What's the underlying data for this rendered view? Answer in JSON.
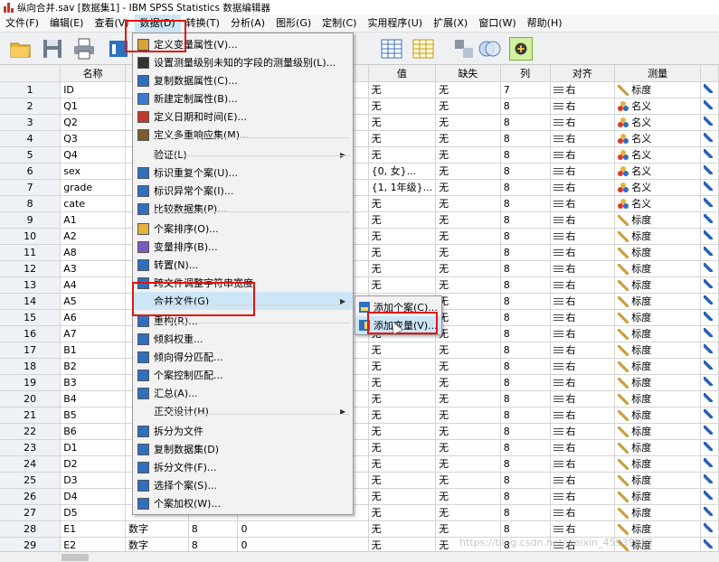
{
  "window": {
    "title": "纵向合并.sav [数据集1] - IBM SPSS Statistics 数据编辑器"
  },
  "menubar": [
    "文件(F)",
    "编辑(E)",
    "查看(V)",
    "数据(D)",
    "转换(T)",
    "分析(A)",
    "图形(G)",
    "定制(C)",
    "实用程序(U)",
    "扩展(X)",
    "窗口(W)",
    "帮助(H)"
  ],
  "grid": {
    "headers": [
      "名称",
      "值",
      "缺失",
      "列",
      "对齐",
      "测量"
    ],
    "rows": [
      {
        "n": "1",
        "name": "ID",
        "type": "",
        "width": "",
        "dec": "",
        "value": "无",
        "missing": "无",
        "cols": "7",
        "align": "右",
        "measure": "标度"
      },
      {
        "n": "2",
        "name": "Q1",
        "type": "",
        "width": "",
        "dec": "",
        "value": "无",
        "missing": "无",
        "cols": "8",
        "align": "右",
        "measure": "名义"
      },
      {
        "n": "3",
        "name": "Q2",
        "type": "",
        "width": "",
        "dec": "",
        "value": "无",
        "missing": "无",
        "cols": "8",
        "align": "右",
        "measure": "名义"
      },
      {
        "n": "4",
        "name": "Q3",
        "type": "",
        "width": "",
        "dec": "",
        "value": "无",
        "missing": "无",
        "cols": "8",
        "align": "右",
        "measure": "名义"
      },
      {
        "n": "5",
        "name": "Q4",
        "type": "",
        "width": "",
        "dec": "",
        "value": "无",
        "missing": "无",
        "cols": "8",
        "align": "右",
        "measure": "名义"
      },
      {
        "n": "6",
        "name": "sex",
        "type": "",
        "width": "",
        "dec": "",
        "value": "{0, 女}...",
        "missing": "无",
        "cols": "8",
        "align": "右",
        "measure": "名义"
      },
      {
        "n": "7",
        "name": "grade",
        "type": "",
        "width": "",
        "dec": "",
        "value": "{1, 1年级}...",
        "missing": "无",
        "cols": "8",
        "align": "右",
        "measure": "名义"
      },
      {
        "n": "8",
        "name": "cate",
        "type": "",
        "width": "",
        "dec": "",
        "value": "无",
        "missing": "无",
        "cols": "8",
        "align": "右",
        "measure": "名义"
      },
      {
        "n": "9",
        "name": "A1",
        "type": "",
        "width": "",
        "dec": "",
        "value": "无",
        "missing": "无",
        "cols": "8",
        "align": "右",
        "measure": "标度"
      },
      {
        "n": "10",
        "name": "A2",
        "type": "",
        "width": "",
        "dec": "",
        "value": "无",
        "missing": "无",
        "cols": "8",
        "align": "右",
        "measure": "标度"
      },
      {
        "n": "11",
        "name": "A8",
        "type": "",
        "width": "",
        "dec": "",
        "value": "无",
        "missing": "无",
        "cols": "8",
        "align": "右",
        "measure": "标度"
      },
      {
        "n": "12",
        "name": "A3",
        "type": "",
        "width": "",
        "dec": "",
        "value": "无",
        "missing": "无",
        "cols": "8",
        "align": "右",
        "measure": "标度"
      },
      {
        "n": "13",
        "name": "A4",
        "type": "",
        "width": "",
        "dec": "",
        "value": "无",
        "missing": "无",
        "cols": "8",
        "align": "右",
        "measure": "标度"
      },
      {
        "n": "14",
        "name": "A5",
        "type": "",
        "width": "",
        "dec": "",
        "value": "无",
        "missing": "无",
        "cols": "8",
        "align": "右",
        "measure": "标度"
      },
      {
        "n": "15",
        "name": "A6",
        "type": "",
        "width": "",
        "dec": "",
        "value": "无",
        "missing": "无",
        "cols": "8",
        "align": "右",
        "measure": "标度"
      },
      {
        "n": "16",
        "name": "A7",
        "type": "",
        "width": "",
        "dec": "",
        "value": "无",
        "missing": "无",
        "cols": "8",
        "align": "右",
        "measure": "标度"
      },
      {
        "n": "17",
        "name": "B1",
        "type": "",
        "width": "",
        "dec": "",
        "value": "无",
        "missing": "无",
        "cols": "8",
        "align": "右",
        "measure": "标度"
      },
      {
        "n": "18",
        "name": "B2",
        "type": "",
        "width": "",
        "dec": "",
        "value": "无",
        "missing": "无",
        "cols": "8",
        "align": "右",
        "measure": "标度"
      },
      {
        "n": "19",
        "name": "B3",
        "type": "",
        "width": "",
        "dec": "",
        "value": "无",
        "missing": "无",
        "cols": "8",
        "align": "右",
        "measure": "标度"
      },
      {
        "n": "20",
        "name": "B4",
        "type": "",
        "width": "",
        "dec": "",
        "value": "无",
        "missing": "无",
        "cols": "8",
        "align": "右",
        "measure": "标度"
      },
      {
        "n": "21",
        "name": "B5",
        "type": "",
        "width": "",
        "dec": "",
        "value": "无",
        "missing": "无",
        "cols": "8",
        "align": "右",
        "measure": "标度"
      },
      {
        "n": "22",
        "name": "B6",
        "type": "",
        "width": "",
        "dec": "",
        "value": "无",
        "missing": "无",
        "cols": "8",
        "align": "右",
        "measure": "标度"
      },
      {
        "n": "23",
        "name": "D1",
        "type": "",
        "width": "",
        "dec": "",
        "value": "无",
        "missing": "无",
        "cols": "8",
        "align": "右",
        "measure": "标度"
      },
      {
        "n": "24",
        "name": "D2",
        "type": "",
        "width": "",
        "dec": "",
        "value": "无",
        "missing": "无",
        "cols": "8",
        "align": "右",
        "measure": "标度"
      },
      {
        "n": "25",
        "name": "D3",
        "type": "",
        "width": "",
        "dec": "",
        "value": "无",
        "missing": "无",
        "cols": "8",
        "align": "右",
        "measure": "标度"
      },
      {
        "n": "26",
        "name": "D4",
        "type": "",
        "width": "",
        "dec": "",
        "value": "无",
        "missing": "无",
        "cols": "8",
        "align": "右",
        "measure": "标度"
      },
      {
        "n": "27",
        "name": "D5",
        "type": "",
        "width": "",
        "dec": "",
        "value": "无",
        "missing": "无",
        "cols": "8",
        "align": "右",
        "measure": "标度"
      },
      {
        "n": "28",
        "name": "E1",
        "type": "数字",
        "width": "8",
        "dec": "0",
        "value": "无",
        "missing": "无",
        "cols": "8",
        "align": "右",
        "measure": "标度"
      },
      {
        "n": "29",
        "name": "E2",
        "type": "数字",
        "width": "8",
        "dec": "0",
        "value": "无",
        "missing": "无",
        "cols": "8",
        "align": "右",
        "measure": "标度"
      }
    ]
  },
  "data_menu": {
    "items": [
      {
        "label": "定义变量属性(V)...",
        "icon": "define-properties-icon",
        "arrow": ""
      },
      {
        "label": "设置测量级别未知的字段的测量级别(L)...",
        "icon": "question-icon",
        "arrow": ""
      },
      {
        "label": "复制数据属性(C)...",
        "icon": "copy-properties-icon",
        "arrow": ""
      },
      {
        "label": "新建定制属性(B)...",
        "icon": "new-attribute-icon",
        "arrow": ""
      },
      {
        "label": "定义日期和时间(E)...",
        "icon": "date-icon",
        "arrow": ""
      },
      {
        "label": "定义多重响应集(M)...",
        "icon": "multiple-response-icon",
        "arrow": ""
      },
      {
        "label": "验证(L)",
        "icon": "",
        "arrow": "▶"
      },
      {
        "label": "标识重复个案(U)...",
        "icon": "duplicate-cases-icon",
        "arrow": ""
      },
      {
        "label": "标识异常个案(I)...",
        "icon": "unusual-cases-icon",
        "arrow": ""
      },
      {
        "label": "比较数据集(P)...",
        "icon": "compare-datasets-icon",
        "arrow": ""
      },
      {
        "label": "个案排序(O)...",
        "icon": "sort-cases-icon",
        "arrow": ""
      },
      {
        "label": "变量排序(B)...",
        "icon": "sort-variables-icon",
        "arrow": ""
      },
      {
        "label": "转置(N)...",
        "icon": "transpose-icon",
        "arrow": ""
      },
      {
        "label": "跨文件调整字符串宽度",
        "icon": "string-width-icon",
        "arrow": ""
      },
      {
        "label": "合并文件(G)",
        "icon": "",
        "arrow": "▶"
      },
      {
        "label": "重构(R)...",
        "icon": "restructure-icon",
        "arrow": ""
      },
      {
        "label": "倾斜权重...",
        "icon": "plus-icon",
        "arrow": ""
      },
      {
        "label": "倾向得分匹配...",
        "icon": "plus-icon",
        "arrow": ""
      },
      {
        "label": "个案控制匹配...",
        "icon": "plus-icon",
        "arrow": ""
      },
      {
        "label": "汇总(A)...",
        "icon": "aggregate-icon",
        "arrow": ""
      },
      {
        "label": "正交设计(H)",
        "icon": "",
        "arrow": "▶"
      },
      {
        "label": "拆分为文件",
        "icon": "plus-icon",
        "arrow": ""
      },
      {
        "label": "复制数据集(D)",
        "icon": "copy-dataset-icon",
        "arrow": ""
      },
      {
        "label": "拆分文件(F)...",
        "icon": "split-file-icon",
        "arrow": ""
      },
      {
        "label": "选择个案(S)...",
        "icon": "select-cases-icon",
        "arrow": ""
      },
      {
        "label": "个案加权(W)...",
        "icon": "weight-cases-icon",
        "arrow": ""
      }
    ]
  },
  "merge_submenu": {
    "items": [
      {
        "label": "添加个案(C)..."
      },
      {
        "label": "添加变量(V)..."
      }
    ]
  },
  "watermark": "https://blog.csdn.net/weixin_45939952",
  "colors": {
    "highlight": "#cde6f7",
    "annotation_red": "#e3140f"
  }
}
